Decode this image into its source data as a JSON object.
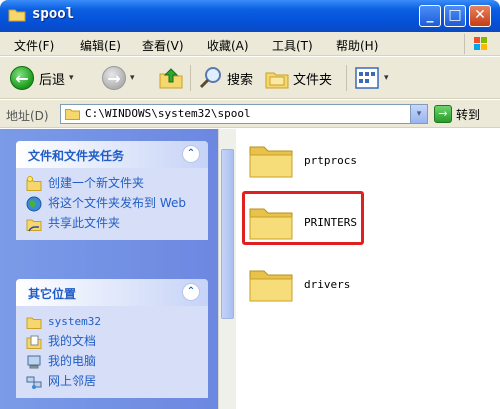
{
  "window": {
    "title": "spool",
    "controls": {
      "minimize": "_",
      "maximize": "□",
      "close": "✕"
    }
  },
  "menu": [
    "文件(F)",
    "编辑(E)",
    "查看(V)",
    "收藏(A)",
    "工具(T)",
    "帮助(H)"
  ],
  "toolbar": {
    "back_label": "后退",
    "search_label": "搜索",
    "folders_label": "文件夹",
    "back_arrow": "←",
    "forward_arrow": "→",
    "dropdown_glyph": "▾"
  },
  "address": {
    "label": "地址(D)",
    "path": "C:\\WINDOWS\\system32\\spool",
    "go_label": "转到",
    "dropdown_glyph": "▾",
    "go_arrow": "→"
  },
  "task_pane": {
    "file_tasks": {
      "title": "文件和文件夹任务",
      "toggle": "⌃",
      "items": [
        "创建一个新文件夹",
        "将这个文件夹发布到 Web",
        "共享此文件夹"
      ]
    },
    "other_places": {
      "title": "其它位置",
      "toggle": "⌃",
      "items": [
        "system32",
        "我的文档",
        "我的电脑",
        "网上邻居"
      ]
    }
  },
  "folders": [
    "prtprocs",
    "PRINTERS",
    "drivers"
  ],
  "highlighted_folder": "PRINTERS",
  "colors": {
    "titlebar": "#0550d8",
    "taskpane_bg": "#7b9be8",
    "link_blue": "#215dc6",
    "highlight_red": "#e02020"
  }
}
